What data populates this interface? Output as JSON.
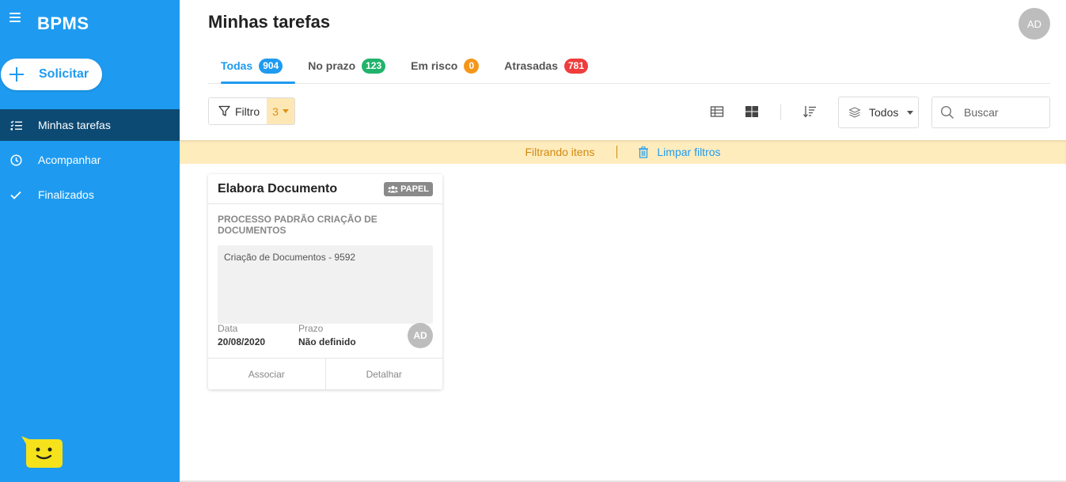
{
  "sidebar": {
    "brand": "BPMS",
    "request_button": "Solicitar",
    "items": [
      {
        "label": "Minhas tarefas",
        "icon": "task-list-icon",
        "active": true
      },
      {
        "label": "Acompanhar",
        "icon": "clock-icon",
        "active": false
      },
      {
        "label": "Finalizados",
        "icon": "check-icon",
        "active": false
      }
    ]
  },
  "header": {
    "title": "Minhas tarefas",
    "avatar_initials": "AD"
  },
  "tabs": [
    {
      "label": "Todas",
      "count": "904",
      "color": "#1e9bf0",
      "active": true
    },
    {
      "label": "No prazo",
      "count": "123",
      "color": "#21b36b",
      "active": false
    },
    {
      "label": "Em risco",
      "count": "0",
      "color": "#f5961b",
      "active": false
    },
    {
      "label": "Atrasadas",
      "count": "781",
      "color": "#ef3d3d",
      "active": false
    }
  ],
  "toolbar": {
    "filter_label": "Filtro",
    "filter_count": "3",
    "scope_select": "Todos",
    "search_placeholder": "Buscar"
  },
  "filter_bar": {
    "status_text": "Filtrando itens",
    "clear_label": "Limpar filtros"
  },
  "card": {
    "title": "Elabora Documento",
    "tag": "PAPEL",
    "process": "PROCESSO PADRÃO CRIAÇÃO DE DOCUMENTOS",
    "description": "Criação de Documentos - 9592",
    "date_label": "Data",
    "date_value": "20/08/2020",
    "deadline_label": "Prazo",
    "deadline_value": "Não definido",
    "avatar_initials": "AD",
    "action_associate": "Associar",
    "action_detail": "Detalhar"
  },
  "colors": {
    "sidebar_bg": "#1e9bf0",
    "sidebar_active": "#0d4a73",
    "accent": "#1e9bf0",
    "filter_bar_bg": "#feecbd"
  }
}
